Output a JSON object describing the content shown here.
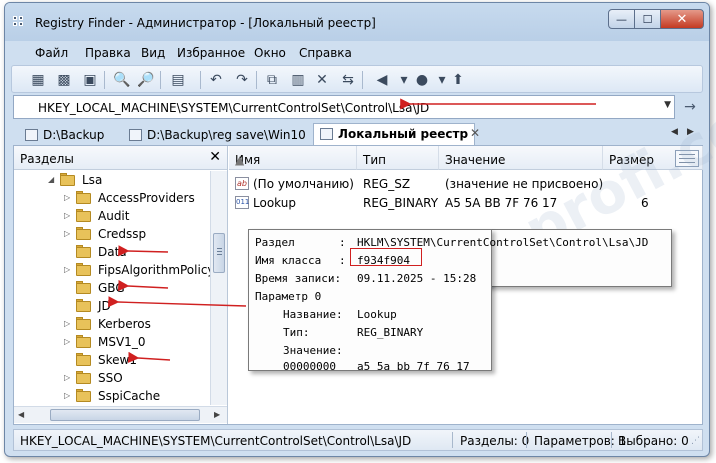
{
  "window": {
    "title": "Registry Finder - Администратор - [Локальный реестр]",
    "controls": {
      "minimize": "—",
      "maximize": "☐",
      "close": "✕"
    }
  },
  "menu": [
    "Файл",
    "Правка",
    "Вид",
    "Избранное",
    "Окно",
    "Справка"
  ],
  "address": {
    "path": "HKEY_LOCAL_MACHINE\\SYSTEM\\CurrentControlSet\\Control\\Lsa\\JD",
    "dropdown": "▼",
    "go": "→"
  },
  "tabs": [
    {
      "label": "D:\\Backup",
      "active": false
    },
    {
      "label": "D:\\Backup\\reg save\\Win10",
      "active": false
    },
    {
      "label": "Локальный реестр",
      "active": true
    }
  ],
  "tab_close": "✕",
  "tab_nav": {
    "left": "◀",
    "right": "▶"
  },
  "left_pane": {
    "title": "Разделы",
    "close": "✕",
    "tree": [
      {
        "label": "Lsa",
        "expander": "◢",
        "level": 0
      },
      {
        "label": "AccessProviders",
        "expander": "▷",
        "level": 1
      },
      {
        "label": "Audit",
        "expander": "▷",
        "level": 1
      },
      {
        "label": "Credssp",
        "expander": "▷",
        "level": 1
      },
      {
        "label": "Data",
        "expander": "",
        "level": 1
      },
      {
        "label": "FipsAlgorithmPolicy",
        "expander": "▷",
        "level": 1
      },
      {
        "label": "GBG",
        "expander": "",
        "level": 1
      },
      {
        "label": "JD",
        "expander": "",
        "level": 1
      },
      {
        "label": "Kerberos",
        "expander": "▷",
        "level": 1
      },
      {
        "label": "MSV1_0",
        "expander": "▷",
        "level": 1
      },
      {
        "label": "Skew1",
        "expander": "",
        "level": 1
      },
      {
        "label": "SSO",
        "expander": "▷",
        "level": 1
      },
      {
        "label": "SspiCache",
        "expander": "▷",
        "level": 1
      }
    ],
    "hscroll": {
      "left": "◀",
      "right": "▶"
    }
  },
  "right_pane": {
    "columns": [
      "Имя",
      "Тип",
      "Значение",
      "Размер"
    ],
    "rows": [
      {
        "icon": "ab",
        "name": "(По умолчанию)",
        "type": "REG_SZ",
        "value": "(значение не присвоено)",
        "size": ""
      },
      {
        "icon": "011",
        "name": "Lookup",
        "type": "REG_BINARY",
        "value": "A5 5A BB 7F 76 17",
        "size": "6"
      }
    ]
  },
  "tooltip": {
    "section_label": "Раздел",
    "section_value": "HKLM\\SYSTEM\\CurrentControlSet\\Control\\Lsa\\JD",
    "class_label": "Имя класса",
    "class_value": "f934f904",
    "time_label": "Время записи:",
    "time_value": "09.11.2025 - 15:28",
    "param_label": "Параметр 0",
    "name_label": "Название:",
    "name_value": "Lookup",
    "type_label": "Тип:",
    "type_value": "REG_BINARY",
    "value_label": "Значение:",
    "hex_offset": "00000000",
    "hex_bytes": "a5 5a bb 7f 76 17",
    "sep": ":"
  },
  "status": {
    "path": "HKEY_LOCAL_MACHINE\\SYSTEM\\CurrentControlSet\\Control\\Lsa\\JD",
    "sections": "Разделы: 0",
    "params": "Параметров: 1",
    "selected": "Выбрано: 0"
  },
  "watermark": "comp-profi.com",
  "colors": {
    "annotation_arrow": "#d02020",
    "window_frame": "#cfdff0"
  }
}
